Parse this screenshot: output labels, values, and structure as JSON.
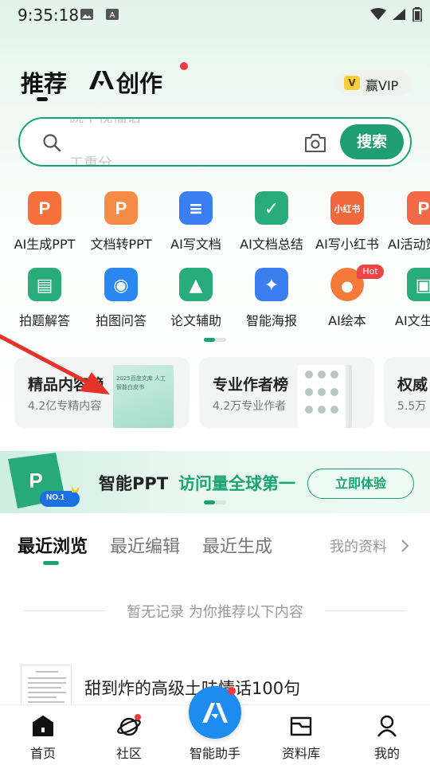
{
  "status_bar": {
    "time": "9:35:18"
  },
  "header": {
    "tabs": [
      {
        "label": "推荐"
      },
      {
        "label": "创作",
        "logo_text": "AI"
      }
    ],
    "vip": {
      "badge": "V",
      "label": "赢VIP"
    }
  },
  "search": {
    "hint_prev": "読中视福语",
    "hint_next": "工重分",
    "button_label": "搜索"
  },
  "tools_row1": [
    {
      "label": "AI生成PPT",
      "icon": "ppt-icon",
      "color": "#f5703a",
      "glyph": "P"
    },
    {
      "label": "文档转PPT",
      "icon": "doc-to-ppt-icon",
      "color": "#f58a45",
      "glyph": "P"
    },
    {
      "label": "AI写文档",
      "icon": "write-doc-icon",
      "color": "#3a7ef0",
      "glyph": "≡"
    },
    {
      "label": "AI文档总结",
      "icon": "summary-icon",
      "color": "#2aab7c",
      "glyph": "✓"
    },
    {
      "label": "AI写小红书",
      "icon": "xiaohongshu-icon",
      "color": "#f0683c",
      "glyph": "小红书"
    },
    {
      "label": "AI活动策",
      "icon": "activity-icon",
      "color": "#f06a48",
      "glyph": "P"
    }
  ],
  "tools_row2": [
    {
      "label": "拍题解答",
      "icon": "photo-question-icon",
      "color": "#2aab7c",
      "glyph": "▤"
    },
    {
      "label": "拍图问答",
      "icon": "camera-icon",
      "color": "#2a87f0",
      "glyph": "◉"
    },
    {
      "label": "论文辅助",
      "icon": "graduation-cap-icon",
      "color": "#2aab7c",
      "glyph": "▲"
    },
    {
      "label": "智能海报",
      "icon": "poster-icon",
      "color": "#3a7ef0",
      "glyph": "✦"
    },
    {
      "label": "AI绘本",
      "icon": "palette-icon",
      "color": "#f57a3a",
      "glyph": "●",
      "badge": "Hot"
    },
    {
      "label": "AI文生",
      "icon": "image-icon",
      "color": "#2aab7c",
      "glyph": "▣"
    }
  ],
  "feature_cards": [
    {
      "title": "精品内容榜",
      "subtitle": "4.2亿专精内容",
      "cover_text": "2025百度文库 人工智能白皮书"
    },
    {
      "title": "专业作者榜",
      "subtitle": "4.2万专业作者"
    },
    {
      "title": "权威",
      "subtitle": "5.5万"
    }
  ],
  "banner": {
    "badge": "NO.1",
    "text1": "智能PPT",
    "text2": "访问量全球第一",
    "button": "立即体验"
  },
  "recent": {
    "tabs": [
      "最近浏览",
      "最近编辑",
      "最近生成"
    ],
    "my_files": "我的资料",
    "empty_text": "暂无记录 为你推荐以下内容",
    "items": [
      {
        "title": "甜到炸的高级土味情话100句"
      }
    ]
  },
  "bottom_nav": [
    {
      "label": "首页",
      "icon": "home-icon"
    },
    {
      "label": "社区",
      "icon": "planet-icon"
    },
    {
      "label": "智能助手",
      "icon": "ai-assistant-icon"
    },
    {
      "label": "资料库",
      "icon": "folder-icon"
    },
    {
      "label": "我的",
      "icon": "profile-icon"
    }
  ],
  "colors": {
    "brand": "#1aa374",
    "accent_red": "#ee3b3b",
    "assistant_blue": "#1d8cf0"
  }
}
